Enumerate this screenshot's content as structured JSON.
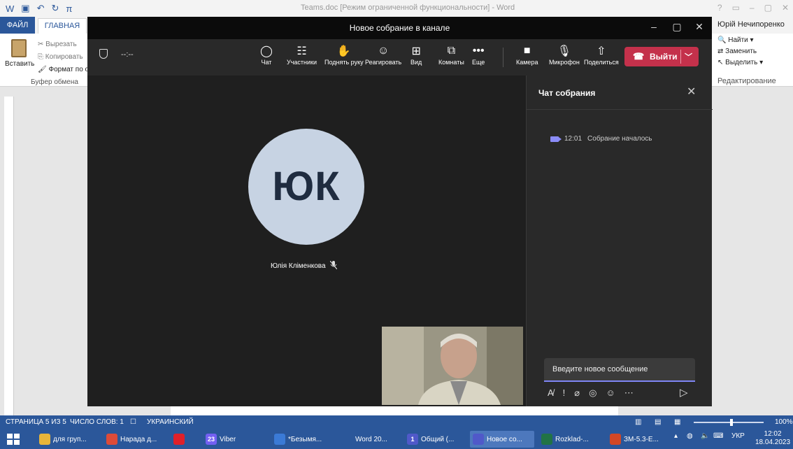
{
  "word": {
    "title": "Teams.doc [Режим ограниченной функциональности] - Word",
    "tab_file": "ФАЙЛ",
    "tab_home": "ГЛАВНАЯ",
    "user": "Юрій Нечипоренко",
    "clipboard": {
      "paste": "Вставить",
      "cut": "Вырезать",
      "copy": "Копировать",
      "format": "Формат по о",
      "group": "Буфер обмена"
    },
    "editing": {
      "find": "Найти",
      "replace": "Заменить",
      "select": "Выделить",
      "group": "Редактирование"
    },
    "status": {
      "page": "СТРАНИЦА 5 ИЗ 5",
      "words": "ЧИСЛО СЛОВ: 1",
      "lang": "УКРАИНСКИЙ",
      "zoom": "100%"
    }
  },
  "teams": {
    "window_title": "Новое собрание в канале",
    "timer": "--:--",
    "toolbar": [
      {
        "icon": "chat-icon",
        "label": "Чат",
        "glyph": "◯"
      },
      {
        "icon": "participants-icon",
        "label": "Участники",
        "glyph": "☷"
      },
      {
        "icon": "raise-hand-icon",
        "label": "Поднять руку",
        "glyph": "✋"
      },
      {
        "icon": "react-icon",
        "label": "Реагировать",
        "glyph": "☺"
      },
      {
        "icon": "view-icon",
        "label": "Вид",
        "glyph": "⊞"
      },
      {
        "icon": "rooms-icon",
        "label": "Комнаты",
        "glyph": "⧉"
      },
      {
        "icon": "more-icon",
        "label": "Еще",
        "glyph": "•••"
      },
      {
        "icon": "camera-icon",
        "label": "Камера",
        "glyph": "■"
      },
      {
        "icon": "microphone-icon",
        "label": "Микрофон",
        "glyph": "🎙"
      },
      {
        "icon": "share-icon",
        "label": "Поделиться",
        "glyph": "⇧"
      }
    ],
    "leave_label": "Выйти",
    "participant": {
      "initials": "ЮК",
      "name": "Юлія Кліменкова"
    },
    "chat": {
      "title": "Чат собрания",
      "event_time": "12:01",
      "event_text": "Собрание началось",
      "input_placeholder": "Введите новое сообщение"
    }
  },
  "taskbar": {
    "items": [
      {
        "label": "для груп...",
        "icon": "folder-icon",
        "color": "#e8b53a"
      },
      {
        "label": "Нарада д...",
        "icon": "chrome-icon",
        "color": "#dd4b39"
      },
      {
        "label": "",
        "icon": "opera-icon",
        "color": "#e0202a"
      },
      {
        "label": "Viber",
        "icon": "viber-icon",
        "color": "#7360f2",
        "badge": "23"
      },
      {
        "label": "*Безымя...",
        "icon": "paint-icon",
        "color": "#3b7ad6"
      },
      {
        "label": "Word 20...",
        "icon": "word-icon",
        "color": "#2b579a"
      },
      {
        "label": "Общий (...",
        "icon": "teams-icon",
        "color": "#5059c9",
        "badge": "1"
      },
      {
        "label": "Новое со...",
        "icon": "teams-icon",
        "color": "#5059c9"
      },
      {
        "label": "Rozklad-...",
        "icon": "excel-icon",
        "color": "#217346"
      },
      {
        "label": "ЗМ-5.3-Е...",
        "icon": "powerpoint-icon",
        "color": "#d24726"
      }
    ],
    "lang": "УКР",
    "time": "12:02",
    "date": "18.04.2023"
  }
}
